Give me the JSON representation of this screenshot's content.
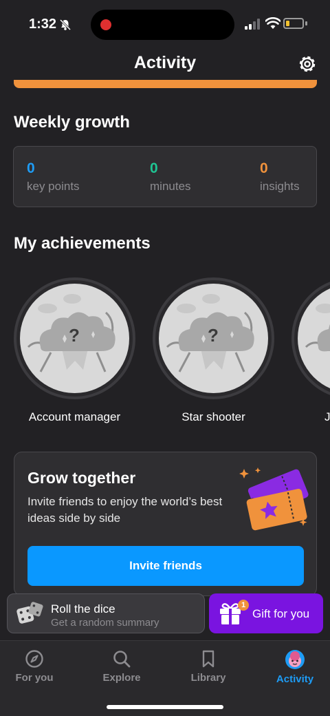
{
  "status_bar": {
    "time": "1:32"
  },
  "header": {
    "title": "Activity"
  },
  "weekly_growth": {
    "title": "Weekly growth",
    "stats": [
      {
        "value": "0",
        "label": "key points",
        "color": "#1e9cf5"
      },
      {
        "value": "0",
        "label": "minutes",
        "color": "#1fc493"
      },
      {
        "value": "0",
        "label": "insights",
        "color": "#f0923c"
      }
    ]
  },
  "achievements": {
    "title": "My achievements",
    "items": [
      {
        "name": "Account manager"
      },
      {
        "name": "Star shooter"
      },
      {
        "name": "J"
      }
    ]
  },
  "grow_together": {
    "title": "Grow together",
    "text": "Invite friends to enjoy the world’s best ideas side by side",
    "button": "Invite friends"
  },
  "roll_dice": {
    "title": "Roll the dice",
    "subtitle": "Get a random summary"
  },
  "gift": {
    "label": "Gift for you",
    "badge": "1"
  },
  "tabs": [
    {
      "label": "For you",
      "icon": "compass-icon",
      "active": false
    },
    {
      "label": "Explore",
      "icon": "search-icon",
      "active": false
    },
    {
      "label": "Library",
      "icon": "bookmark-icon",
      "active": false
    },
    {
      "label": "Activity",
      "icon": "avatar-icon",
      "active": true
    }
  ],
  "colors": {
    "accent": "#1e9cf5",
    "gift": "#7a14e0",
    "orange": "#f0923c"
  }
}
